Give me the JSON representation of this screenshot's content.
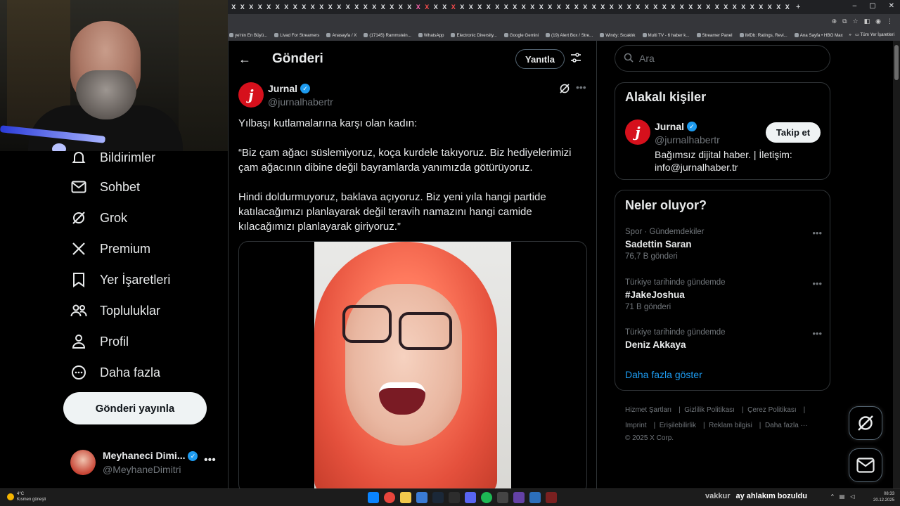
{
  "browser": {
    "tab_glyph": "X",
    "bookmarks": [
      "ye'nin En Büyü...",
      "Livad For Streamers",
      "Anasayfa / X",
      "(17145) Rammstein...",
      "WhatsApp",
      "Electronic Diversity...",
      "Google Gemini",
      "(19) Alert Box / Stre...",
      "Windy: Sıcaklık",
      "Multi TV - 6 haber k...",
      "Streamer Panel",
      "IMDb: Ratings, Revi...",
      "Ana Sayfa • HBO Max"
    ],
    "bookmarks_more": "»",
    "bookmarks_folder": "Tüm Yer İşaretleri",
    "new_tab": "+"
  },
  "sidebar": {
    "items": [
      {
        "label": "Bildirimler",
        "icon": "bell-icon"
      },
      {
        "label": "Sohbet",
        "icon": "mail-icon"
      },
      {
        "label": "Grok",
        "icon": "grok-icon"
      },
      {
        "label": "Premium",
        "icon": "x-logo-icon"
      },
      {
        "label": "Yer İşaretleri",
        "icon": "bookmark-icon"
      },
      {
        "label": "Topluluklar",
        "icon": "people-icon"
      },
      {
        "label": "Profil",
        "icon": "person-icon"
      },
      {
        "label": "Daha fazla",
        "icon": "more-circle-icon"
      }
    ],
    "post_button": "Gönderi yayınla",
    "account": {
      "name": "Meyhaneci Dimi...",
      "handle": "@MeyhaneDimitri",
      "more": "•••"
    }
  },
  "main": {
    "back": "←",
    "title": "Gönderi",
    "reply_button": "Yanıtla",
    "tweet": {
      "author_name": "Jurnal",
      "author_handle": "@jurnalhabertr",
      "logo_letter": "j",
      "more": "•••",
      "text": [
        "Yılbaşı kutlamalarına karşı olan kadın:",
        "“Biz çam ağacı süslemiyoruz, koça kurdele takıyoruz. Biz hediyelerimizi çam ağacının dibine değil bayramlarda yanımızda götürüyoruz.",
        "Hindi doldurmuyoruz, baklava açıyoruz. Biz yeni yıla hangi partide katılacağımızı planlayarak değil teravih namazını hangi camide kılacağımızı planlayarak giriyoruz.”"
      ]
    }
  },
  "right": {
    "search_placeholder": "Ara",
    "related": {
      "title": "Alakalı kişiler",
      "name": "Jurnal",
      "handle": "@jurnalhabertr",
      "bio": "Bağımsız dijital haber. | İletişim: info@jurnalhaber.tr",
      "follow_button": "Takip et"
    },
    "trends": {
      "title": "Neler oluyor?",
      "items": [
        {
          "meta": "Spor · Gündemdekiler",
          "topic": "Sadettin Saran",
          "count": "76,7 B gönderi"
        },
        {
          "meta": "Türkiye tarihinde gündemde",
          "topic": "#JakeJoshua",
          "count": "71 B gönderi"
        },
        {
          "meta": "Türkiye tarihinde gündemde",
          "topic": "Deniz Akkaya",
          "count": ""
        }
      ],
      "dots": "•••",
      "show_more": "Daha fazla göster"
    },
    "footer": [
      "Hizmet Şartları",
      "Gizlilik Politikası",
      "Çerez Politikası",
      "Imprint",
      "Erişilebilirlik",
      "Reklam bilgisi",
      "Daha fazla ···",
      "© 2025 X Corp."
    ]
  },
  "taskbar": {
    "weather_temp": "4°C",
    "weather_desc": "Kısmen güneşli",
    "ticker_user": "vakkur",
    "ticker_msg": "ay ahlakım bozuldu",
    "time": "08:33",
    "date": "20.12.2025"
  },
  "colors": {
    "accent": "#1d9bf0",
    "jurnal_red": "#d6101c",
    "background": "#000000"
  }
}
